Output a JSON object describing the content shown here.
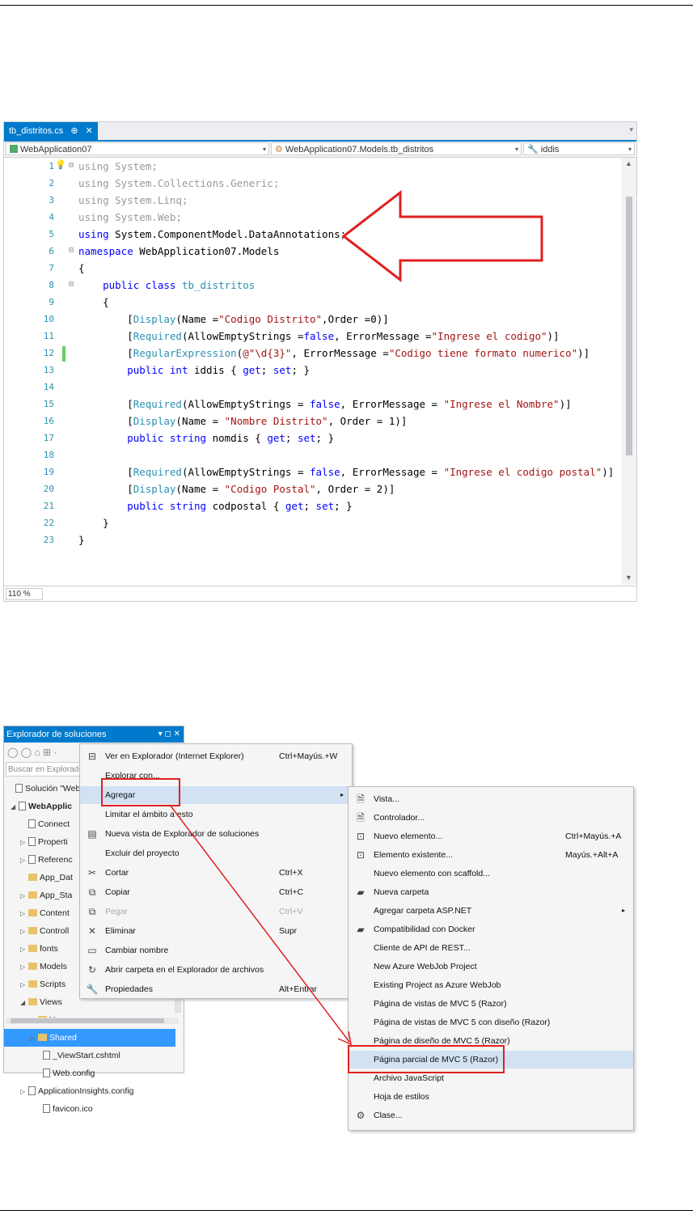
{
  "editor": {
    "tab": {
      "filename": "tb_distritos.cs",
      "pin": "⊕",
      "close": "✕"
    },
    "nav": {
      "project": "WebApplication07",
      "class": "WebApplication07.Models.tb_distritos",
      "member": "iddis"
    },
    "zoom": "110 %",
    "lines": [
      {
        "n": "1",
        "segs": [
          {
            "c": "gr",
            "t": "using System;"
          }
        ]
      },
      {
        "n": "2",
        "segs": [
          {
            "c": "gr",
            "t": "using System.Collections.Generic;"
          }
        ]
      },
      {
        "n": "3",
        "segs": [
          {
            "c": "gr",
            "t": "using System.Linq;"
          }
        ]
      },
      {
        "n": "4",
        "segs": [
          {
            "c": "gr",
            "t": "using System.Web;"
          }
        ]
      },
      {
        "n": "5",
        "segs": [
          {
            "c": "kw",
            "t": "using"
          },
          {
            "c": "",
            "t": " System.ComponentModel.DataAnnotations;"
          }
        ]
      },
      {
        "n": "6",
        "segs": [
          {
            "c": "kw",
            "t": "namespace"
          },
          {
            "c": "",
            "t": " WebApplication07.Models"
          }
        ]
      },
      {
        "n": "7",
        "segs": [
          {
            "c": "",
            "t": "{"
          }
        ]
      },
      {
        "n": "8",
        "segs": [
          {
            "c": "",
            "t": "    "
          },
          {
            "c": "kw",
            "t": "public class"
          },
          {
            "c": "",
            "t": " "
          },
          {
            "c": "ty",
            "t": "tb_distritos"
          }
        ]
      },
      {
        "n": "9",
        "segs": [
          {
            "c": "",
            "t": "    {"
          }
        ]
      },
      {
        "n": "10",
        "segs": [
          {
            "c": "",
            "t": "        ["
          },
          {
            "c": "ty",
            "t": "Display"
          },
          {
            "c": "",
            "t": "(Name ="
          },
          {
            "c": "st",
            "t": "\"Codigo Distrito\""
          },
          {
            "c": "",
            "t": ",Order =0)]"
          }
        ]
      },
      {
        "n": "11",
        "segs": [
          {
            "c": "",
            "t": "        ["
          },
          {
            "c": "ty",
            "t": "Required"
          },
          {
            "c": "",
            "t": "(AllowEmptyStrings ="
          },
          {
            "c": "kw",
            "t": "false"
          },
          {
            "c": "",
            "t": ", ErrorMessage ="
          },
          {
            "c": "st",
            "t": "\"Ingrese el codigo\""
          },
          {
            "c": "",
            "t": ")]"
          }
        ]
      },
      {
        "n": "12",
        "segs": [
          {
            "c": "",
            "t": "        ["
          },
          {
            "c": "ty",
            "t": "RegularExpression"
          },
          {
            "c": "",
            "t": "("
          },
          {
            "c": "st",
            "t": "@\"\\d{3}\""
          },
          {
            "c": "",
            "t": ", ErrorMessage ="
          },
          {
            "c": "st",
            "t": "\"Codigo tiene formato numerico\""
          },
          {
            "c": "",
            "t": ")]"
          }
        ]
      },
      {
        "n": "13",
        "segs": [
          {
            "c": "",
            "t": "        "
          },
          {
            "c": "kw",
            "t": "public int"
          },
          {
            "c": "",
            "t": " iddis { "
          },
          {
            "c": "kw",
            "t": "get"
          },
          {
            "c": "",
            "t": "; "
          },
          {
            "c": "kw",
            "t": "set"
          },
          {
            "c": "",
            "t": "; }"
          }
        ]
      },
      {
        "n": "14",
        "segs": [
          {
            "c": "",
            "t": ""
          }
        ]
      },
      {
        "n": "15",
        "segs": [
          {
            "c": "",
            "t": "        ["
          },
          {
            "c": "ty",
            "t": "Required"
          },
          {
            "c": "",
            "t": "(AllowEmptyStrings = "
          },
          {
            "c": "kw",
            "t": "false"
          },
          {
            "c": "",
            "t": ", ErrorMessage = "
          },
          {
            "c": "st",
            "t": "\"Ingrese el Nombre\""
          },
          {
            "c": "",
            "t": ")]"
          }
        ]
      },
      {
        "n": "16",
        "segs": [
          {
            "c": "",
            "t": "        ["
          },
          {
            "c": "ty",
            "t": "Display"
          },
          {
            "c": "",
            "t": "(Name = "
          },
          {
            "c": "st",
            "t": "\"Nombre Distrito\""
          },
          {
            "c": "",
            "t": ", Order = 1)]"
          }
        ]
      },
      {
        "n": "17",
        "segs": [
          {
            "c": "",
            "t": "        "
          },
          {
            "c": "kw",
            "t": "public string"
          },
          {
            "c": "",
            "t": " nomdis { "
          },
          {
            "c": "kw",
            "t": "get"
          },
          {
            "c": "",
            "t": "; "
          },
          {
            "c": "kw",
            "t": "set"
          },
          {
            "c": "",
            "t": "; }"
          }
        ]
      },
      {
        "n": "18",
        "segs": [
          {
            "c": "",
            "t": ""
          }
        ]
      },
      {
        "n": "19",
        "segs": [
          {
            "c": "",
            "t": "        ["
          },
          {
            "c": "ty",
            "t": "Required"
          },
          {
            "c": "",
            "t": "(AllowEmptyStrings = "
          },
          {
            "c": "kw",
            "t": "false"
          },
          {
            "c": "",
            "t": ", ErrorMessage = "
          },
          {
            "c": "st",
            "t": "\"Ingrese el codigo postal\""
          },
          {
            "c": "",
            "t": ")]"
          }
        ]
      },
      {
        "n": "20",
        "segs": [
          {
            "c": "",
            "t": "        ["
          },
          {
            "c": "ty",
            "t": "Display"
          },
          {
            "c": "",
            "t": "(Name = "
          },
          {
            "c": "st",
            "t": "\"Codigo Postal\""
          },
          {
            "c": "",
            "t": ", Order = 2)]"
          }
        ]
      },
      {
        "n": "21",
        "segs": [
          {
            "c": "",
            "t": "        "
          },
          {
            "c": "kw",
            "t": "public string"
          },
          {
            "c": "",
            "t": " codpostal { "
          },
          {
            "c": "kw",
            "t": "get"
          },
          {
            "c": "",
            "t": "; "
          },
          {
            "c": "kw",
            "t": "set"
          },
          {
            "c": "",
            "t": "; }"
          }
        ]
      },
      {
        "n": "22",
        "segs": [
          {
            "c": "",
            "t": "    }"
          }
        ]
      },
      {
        "n": "23",
        "segs": [
          {
            "c": "",
            "t": "}"
          }
        ]
      }
    ]
  },
  "solution_explorer": {
    "title": "Explorador de soluciones",
    "title_controls": "▾ ◻ ✕",
    "toolbar": "◯ ◯ ⌂ ⊞ ·",
    "search_placeholder": "Buscar en Explorado",
    "items": [
      {
        "label": "Solución \"Web",
        "icon": "solution-icon",
        "tri": ""
      },
      {
        "label": "WebApplic",
        "icon": "project-icon",
        "tri": "◢",
        "bold": true
      },
      {
        "label": "Connect",
        "icon": "connected-icon",
        "tri": ""
      },
      {
        "label": "Properti",
        "icon": "wrench-icon",
        "tri": "▷"
      },
      {
        "label": "Referenc",
        "icon": "references-icon",
        "tri": "▷"
      },
      {
        "label": "App_Dat",
        "icon": "folder-icon",
        "tri": ""
      },
      {
        "label": "App_Sta",
        "icon": "folder-icon",
        "tri": "▷"
      },
      {
        "label": "Content",
        "icon": "folder-icon",
        "tri": "▷"
      },
      {
        "label": "Controll",
        "icon": "folder-icon",
        "tri": "▷"
      },
      {
        "label": "fonts",
        "icon": "folder-icon",
        "tri": "▷"
      },
      {
        "label": "Models",
        "icon": "folder-icon",
        "tri": "▷"
      },
      {
        "label": "Scripts",
        "icon": "folder-icon",
        "tri": "▷"
      },
      {
        "label": "Views",
        "icon": "folder-icon",
        "tri": "◢"
      },
      {
        "label": "Hom",
        "icon": "folder-icon",
        "tri": "▷"
      },
      {
        "label": "Shared",
        "icon": "folder-icon",
        "tri": "▷",
        "selected": true
      },
      {
        "label": "_ViewStart.cshtml",
        "icon": "cshtml-icon",
        "tri": ""
      },
      {
        "label": "Web.config",
        "icon": "config-icon",
        "tri": ""
      },
      {
        "label": "ApplicationInsights.config",
        "icon": "config-icon",
        "tri": "▷"
      },
      {
        "label": "favicon.ico",
        "icon": "ico-icon",
        "tri": ""
      }
    ]
  },
  "context_menu": {
    "items": [
      {
        "label": "Ver en Explorador (Internet Explorer)",
        "shortcut": "Ctrl+Mayús.+W",
        "icon": "browser-icon",
        "glyph": "⊟"
      },
      {
        "label": "Explorar con...",
        "shortcut": "",
        "icon": "",
        "glyph": ""
      },
      {
        "label": "Agregar",
        "shortcut": "▸",
        "icon": "",
        "glyph": "",
        "highlight": true
      },
      {
        "label": "Limitar el ámbito a esto",
        "shortcut": "",
        "icon": "",
        "glyph": ""
      },
      {
        "label": "Nueva vista de Explorador de soluciones",
        "shortcut": "",
        "icon": "new-view-icon",
        "glyph": "▤"
      },
      {
        "label": "Excluir del proyecto",
        "shortcut": "",
        "icon": "",
        "glyph": ""
      },
      {
        "label": "Cortar",
        "shortcut": "Ctrl+X",
        "icon": "scissors-icon",
        "glyph": "✂"
      },
      {
        "label": "Copiar",
        "shortcut": "Ctrl+C",
        "icon": "copy-icon",
        "glyph": "⧉"
      },
      {
        "label": "Pegar",
        "shortcut": "Ctrl+V",
        "icon": "paste-icon",
        "glyph": "⧉",
        "disabled": true
      },
      {
        "label": "Eliminar",
        "shortcut": "Supr",
        "icon": "delete-icon",
        "glyph": "✕"
      },
      {
        "label": "Cambiar nombre",
        "shortcut": "",
        "icon": "rename-icon",
        "glyph": "▭"
      },
      {
        "label": "Abrir carpeta en el Explorador de archivos",
        "shortcut": "",
        "icon": "refresh-icon",
        "glyph": "↻"
      },
      {
        "label": "Propiedades",
        "shortcut": "Alt+Entrar",
        "icon": "wrench-icon",
        "glyph": "🔧"
      }
    ]
  },
  "submenu": {
    "items": [
      {
        "label": "Vista...",
        "shortcut": "",
        "icon": "view-file-icon",
        "glyph": "🗎"
      },
      {
        "label": "Controlador...",
        "shortcut": "",
        "icon": "controller-icon",
        "glyph": "🗎"
      },
      {
        "label": "Nuevo elemento...",
        "shortcut": "Ctrl+Mayús.+A",
        "icon": "new-item-icon",
        "glyph": "⊡"
      },
      {
        "label": "Elemento existente...",
        "shortcut": "Mayús.+Alt+A",
        "icon": "existing-item-icon",
        "glyph": "⊡"
      },
      {
        "label": "Nuevo elemento con scaffold...",
        "shortcut": "",
        "icon": "",
        "glyph": ""
      },
      {
        "label": "Nueva carpeta",
        "shortcut": "",
        "icon": "new-folder-icon",
        "glyph": "▰"
      },
      {
        "label": "Agregar carpeta ASP.NET",
        "shortcut": "▸",
        "icon": "",
        "glyph": ""
      },
      {
        "label": "Compatibilidad con Docker",
        "shortcut": "",
        "icon": "docker-icon",
        "glyph": "▰"
      },
      {
        "label": "Cliente de API de REST...",
        "shortcut": "",
        "icon": "",
        "glyph": ""
      },
      {
        "label": "New Azure WebJob Project",
        "shortcut": "",
        "icon": "",
        "glyph": ""
      },
      {
        "label": "Existing Project as Azure WebJob",
        "shortcut": "",
        "icon": "",
        "glyph": ""
      },
      {
        "label": "Página de vistas de MVC 5 (Razor)",
        "shortcut": "",
        "icon": "",
        "glyph": ""
      },
      {
        "label": "Página de vistas de MVC 5 con diseño (Razor)",
        "shortcut": "",
        "icon": "",
        "glyph": ""
      },
      {
        "label": "Página de diseño de MVC 5 (Razor)",
        "shortcut": "",
        "icon": "",
        "glyph": ""
      },
      {
        "label": "Página parcial de MVC 5 (Razor)",
        "shortcut": "",
        "icon": "",
        "glyph": "",
        "highlight": true
      },
      {
        "label": "Archivo JavaScript",
        "shortcut": "",
        "icon": "",
        "glyph": ""
      },
      {
        "label": "Hoja de estilos",
        "shortcut": "",
        "icon": "",
        "glyph": ""
      },
      {
        "label": "Clase...",
        "shortcut": "",
        "icon": "class-icon",
        "glyph": "⚙"
      }
    ]
  },
  "colors": {
    "accent": "#007acc",
    "highlight": "#d2e2f3",
    "annotation": "#e02020",
    "selection": "#3399ff"
  }
}
